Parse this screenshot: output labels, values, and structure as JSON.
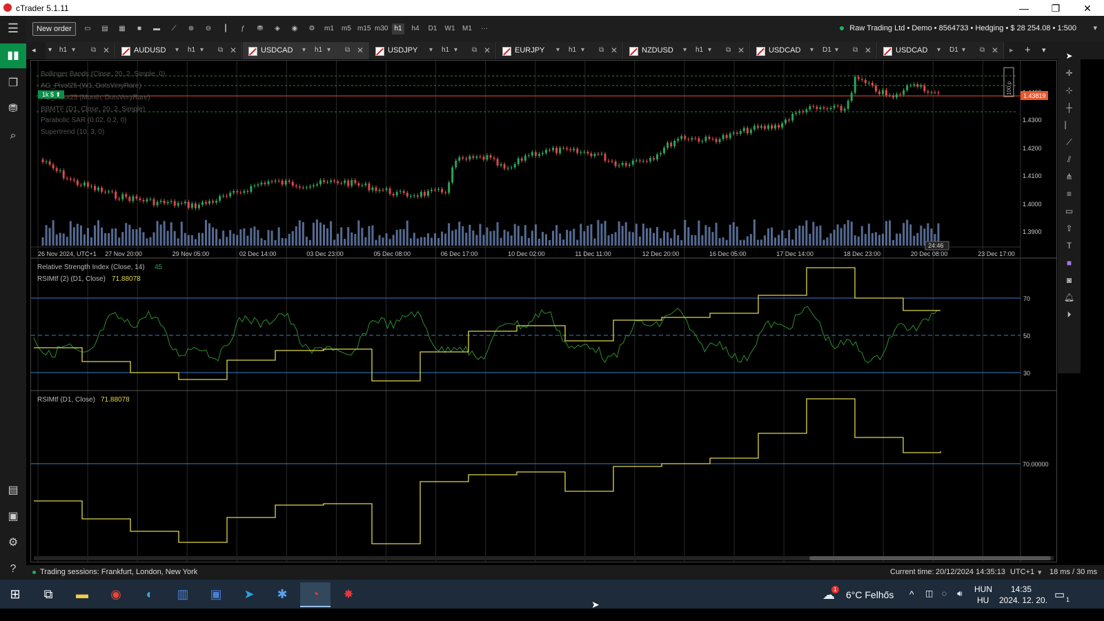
{
  "window": {
    "title": "cTrader 5.1.11"
  },
  "toolbar": {
    "new_order": "New order",
    "timeframes": [
      "m1",
      "m5",
      "m15",
      "m30",
      "h1",
      "h4",
      "D1",
      "W1",
      "M1"
    ],
    "more": "···",
    "account": "Raw Trading Ltd • Demo • 8564733 • Hedging • $ 28 254.08 • 1:500"
  },
  "tabs": [
    {
      "symbol": "",
      "tf": "h1"
    },
    {
      "symbol": "AUDUSD",
      "tf": "h1"
    },
    {
      "symbol": "USDCAD",
      "tf": "h1"
    },
    {
      "symbol": "USDJPY",
      "tf": "h1"
    },
    {
      "symbol": "EURJPY",
      "tf": "h1"
    },
    {
      "symbol": "NZDUSD",
      "tf": "h1"
    },
    {
      "symbol": "USDCAD",
      "tf": "D1"
    },
    {
      "symbol": "USDCAD",
      "tf": "D1"
    }
  ],
  "indicators": {
    "list": [
      "Bollinger Bands (Close, 20, 2, Simple, 0)",
      "AG_Pivot25 (W1, DotsVeryRare)",
      "AG_Pivot25 (Month, DotsVeryRare)",
      "BBMTF (D1, Close, 20, 2, Simple)",
      "Parabolic SAR (0.02, 0.2, 0)",
      "Supertrend (10, 3, 0)"
    ],
    "rsi_label": "Relative Strength Index (Close, 14)",
    "rsi_value": "45",
    "rsimtf2_label": "RSIMtf (2) (D1, Close)",
    "rsimtf2_value": "71.88078",
    "rsimtf_label": "RSIMtf (D1, Close)",
    "rsimtf_value": "71.88078",
    "position_badge": "1k $ ⬆",
    "range_marker": "100 p"
  },
  "price_axis": {
    "labels": [
      "1.4400",
      "1.4300",
      "1.4200",
      "1.4100",
      "1.4000",
      "1.3900"
    ],
    "current": "1.43819",
    "rsi_levels": [
      "70",
      "50",
      "30"
    ],
    "rsimtf_level": "70.00000"
  },
  "time_axis": {
    "labels": [
      "26 Nov 2024, UTC+1",
      "27 Nov 20:00",
      "29 Nov 05:00",
      "02 Dec 14:00",
      "03 Dec 23:00",
      "05 Dec 08:00",
      "06 Dec 17:00",
      "10 Dec 02:00",
      "11 Dec 11:00",
      "12 Dec 20:00",
      "16 Dec 05:00",
      "17 Dec 14:00",
      "18 Dec 23:00",
      "20 Dec 08:00",
      "23 Dec 17:00"
    ],
    "countdown": "24:46"
  },
  "status": {
    "sessions": "Trading sessions: Frankfurt, London, New York",
    "current_time_label": "Current time:",
    "current_time": "20/12/2024 14:35:13",
    "tz": "UTC+1",
    "latency": "18 ms / 30 ms"
  },
  "taskbar": {
    "weather": "6°C  Felhős",
    "lang1": "HUN",
    "lang2": "HU",
    "time": "14:35",
    "date": "2024. 12. 20.",
    "weather_badge": "1",
    "notif_count": "1"
  },
  "colors": {
    "green_accent": "#0a8f4b",
    "candle_up": "#2ea35a",
    "candle_down": "#d94a4a",
    "rsi_line": "#2e8f2e",
    "rsimtf_line": "#e0d84a",
    "level_line": "#3c7fc8",
    "price_badge": "#e8572a"
  }
}
